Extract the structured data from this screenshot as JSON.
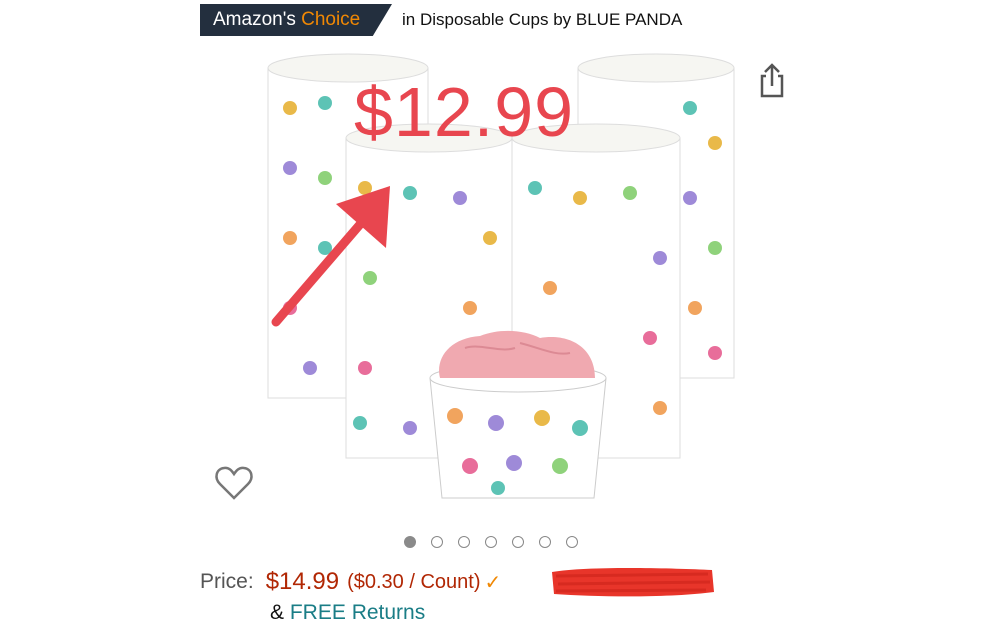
{
  "badge": {
    "prefix": "Amazon's",
    "highlight": "Choice",
    "category": "in Disposable Cups by BLUE PANDA"
  },
  "overlay": {
    "price": "$12.99",
    "arrow_color": "#e8464f"
  },
  "carousel": {
    "count": 7,
    "active_index": 0
  },
  "price": {
    "label": "Price:",
    "amount": "$14.99",
    "unit_price": "($0.30 / Count)",
    "check_icon": "checkmark-icon",
    "color": "#b12704"
  },
  "returns": {
    "prefix": "&",
    "link": "FREE Returns"
  },
  "icons": {
    "share": "share-icon",
    "wishlist": "heart-icon"
  },
  "colors": {
    "badge_bg": "#232f3e",
    "choice": "#f08804",
    "link": "#1a7d86",
    "redaction": "#e8352a"
  }
}
